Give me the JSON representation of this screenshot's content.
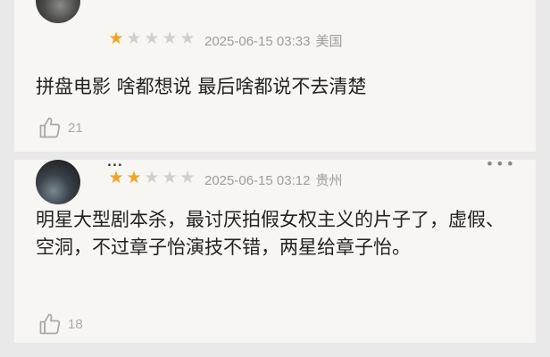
{
  "comments": [
    {
      "username": "",
      "rating": 1,
      "max_rating": 5,
      "time": "2025-06-15 03:33",
      "region": "美国",
      "content": "拼盘电影 啥都想说 最后啥都说不去清楚",
      "likes": "21",
      "icons": {
        "avatar": "avatar",
        "like": "thumbs-up-icon"
      }
    },
    {
      "username": "...",
      "rating": 2,
      "max_rating": 5,
      "time": "2025-06-15 03:12",
      "region": "贵州",
      "content": "明星大型剧本杀，最讨厌拍假女权主义的片子了，虚假、空洞，不过章子怡演技不错，两星给章子怡。",
      "likes": "18",
      "icons": {
        "avatar": "avatar",
        "like": "thumbs-up-icon",
        "more": "more-icon"
      }
    }
  ],
  "colors": {
    "star_on": "#f0a421",
    "star_off": "#cfcfcf",
    "meta_text": "#9c9c9c",
    "card_bg": "#f7f6f2",
    "page_bg": "#e9e9e9"
  }
}
